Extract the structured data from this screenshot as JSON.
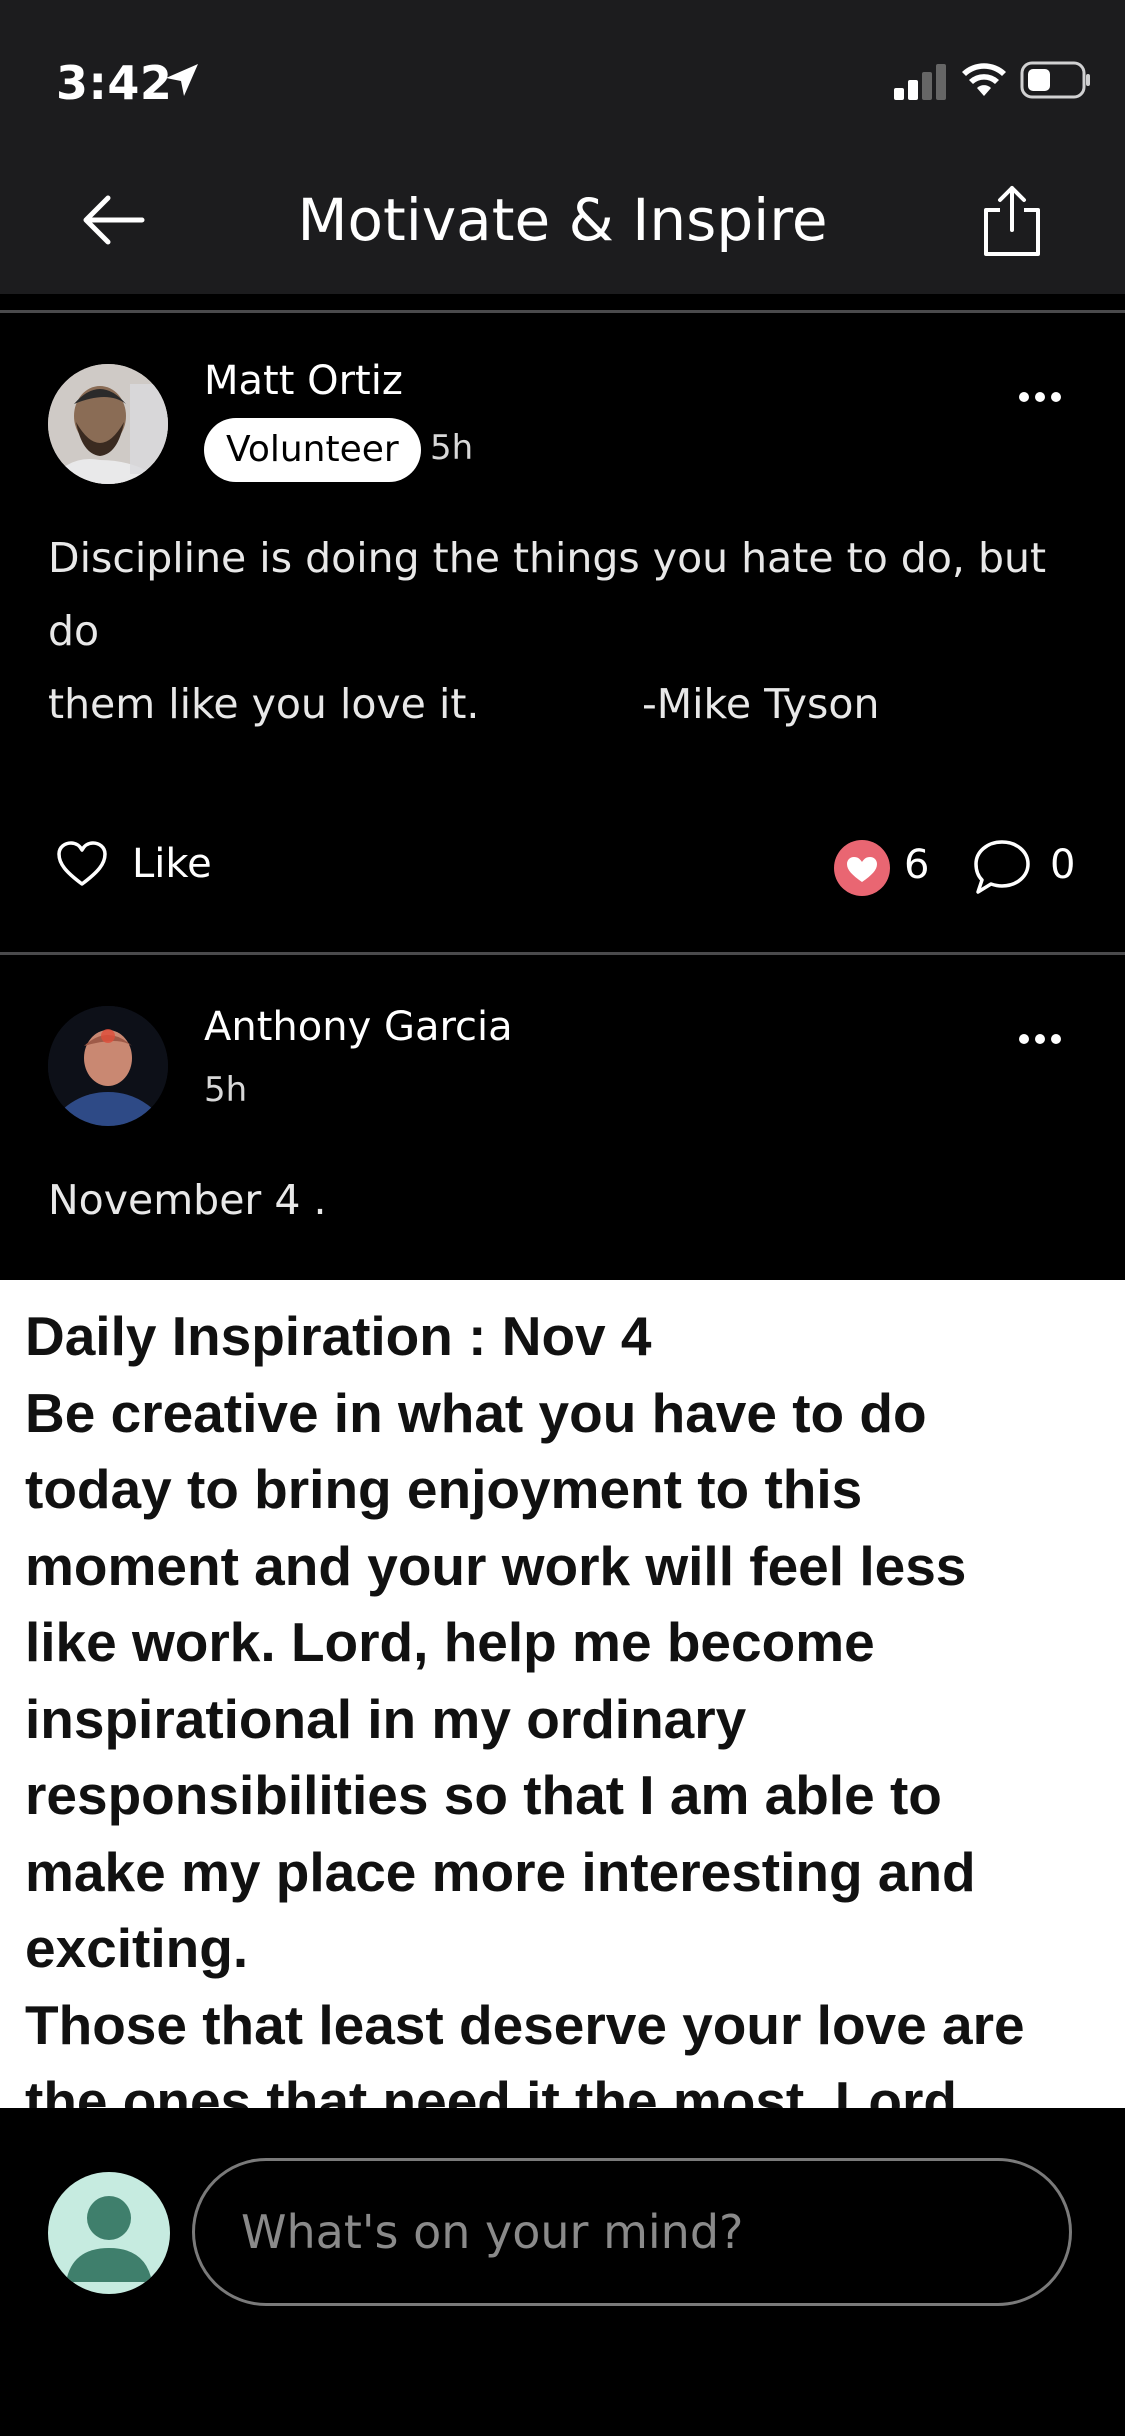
{
  "status_bar": {
    "time": "3:42"
  },
  "nav": {
    "title": "Motivate & Inspire",
    "back_icon": "arrow-left-icon",
    "share_icon": "share-icon"
  },
  "posts": [
    {
      "author": "Matt Ortiz",
      "badge": "Volunteer",
      "time": "5h",
      "text_lines": [
        "Discipline is doing the things you hate to do, but do",
        "them like you love it."
      ],
      "attribution": "-Mike Tyson",
      "like_label": "Like",
      "reaction_count": "6",
      "comment_count": "0"
    },
    {
      "author": "Anthony Garcia",
      "time": "5h",
      "text": "November 4 .",
      "image_lines": [
        "Daily Inspiration : Nov 4",
        "Be creative in what you have to do",
        "today to bring enjoyment to this",
        "moment and your work will feel less",
        "like work. Lord, help me become",
        "inspirational in my ordinary",
        "responsibilities so that I am able to",
        "make my place more interesting and",
        "exciting.",
        "Those that least deserve your love are",
        "the ones that need it the most. Lord"
      ]
    }
  ],
  "composer": {
    "placeholder": "What's on your mind?"
  },
  "colors": {
    "reaction": "#e96672",
    "avatar_bg": "#c6ebe0",
    "avatar_fg": "#3f7f6c"
  }
}
